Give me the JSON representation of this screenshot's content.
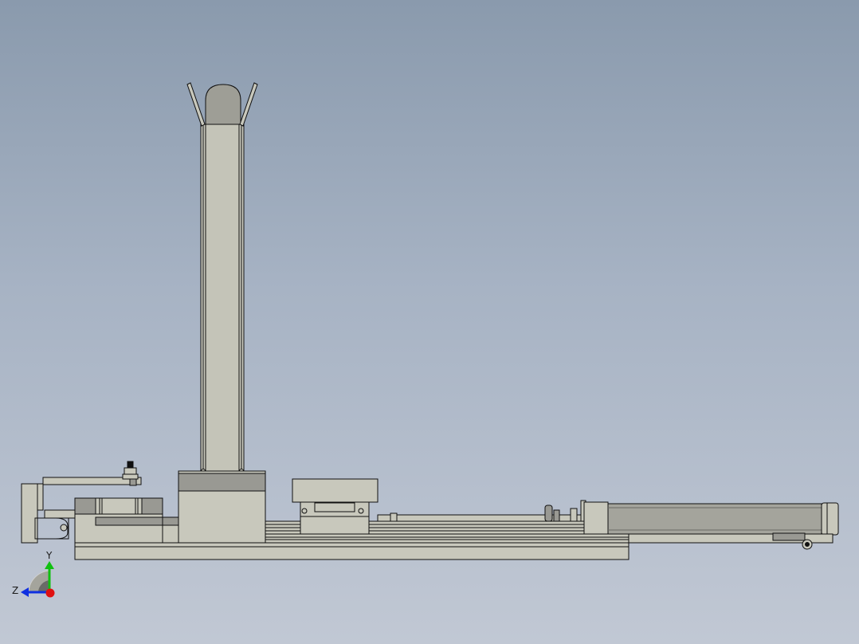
{
  "viewport": {
    "background_top": "#8a9aad",
    "background_bottom": "#c1c8d4"
  },
  "model": {
    "part_fill": "#c8c8bc",
    "part_dark_fill": "#999993",
    "edge_color": "#101010"
  },
  "triad": {
    "y_label": "Y",
    "z_label": "Z",
    "x_color": "#e01010",
    "y_color": "#10c010",
    "z_color": "#1030e0"
  }
}
